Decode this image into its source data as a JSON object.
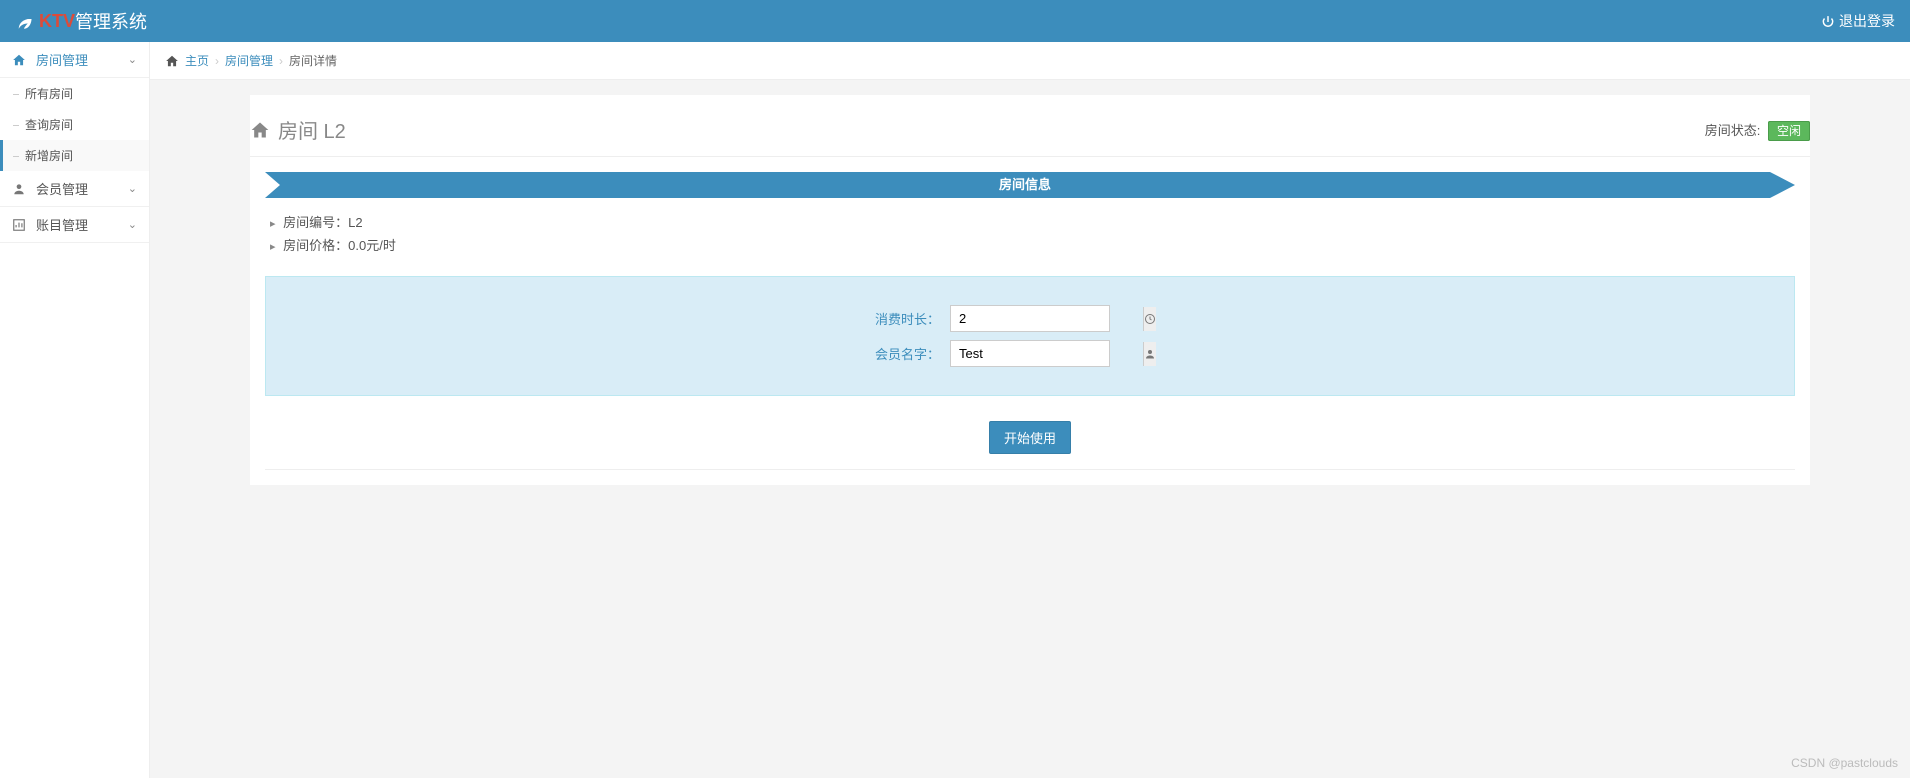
{
  "header": {
    "brand_ktv": "KTV",
    "brand_rest": " 管理系统",
    "logout": "退出登录"
  },
  "sidebar": {
    "room_mgmt": "房间管理",
    "sub_all": "所有房间",
    "sub_query": "查询房间",
    "sub_new": "新增房间",
    "member_mgmt": "会员管理",
    "account_mgmt": "账目管理"
  },
  "breadcrumb": {
    "home": "主页",
    "room": "房间管理",
    "detail": "房间详情"
  },
  "page": {
    "title": "房间 L2",
    "status_label": "房间状态:",
    "status_value": "空闲",
    "section_title": "房间信息",
    "room_no_label": "房间编号：",
    "room_no_value": "L2",
    "price_label": "房间价格：",
    "price_value": "0.0元/时"
  },
  "form": {
    "duration_label": "消费时长：",
    "duration_value": "2",
    "member_label": "会员名字：",
    "member_value": "Test",
    "submit": "开始使用"
  },
  "watermark": "CSDN @pastclouds"
}
